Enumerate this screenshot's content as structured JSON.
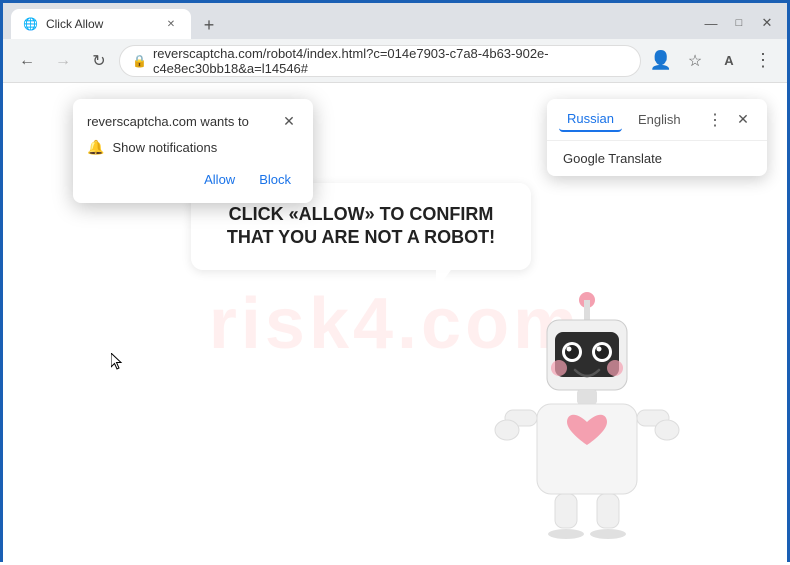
{
  "browser": {
    "tab": {
      "title": "Click Allow",
      "favicon": "🌐"
    },
    "new_tab_icon": "+",
    "nav": {
      "back_label": "←",
      "forward_label": "→",
      "reload_label": "↻"
    },
    "address": "reverscaptcha.com/robot4/index.html?c=014e7903-c7a8-4b63-902e-c4e8ec30bb18&a=l14546#",
    "window_controls": {
      "minimize": "—",
      "maximize": "□",
      "close": "✕"
    }
  },
  "notification_popup": {
    "title": "reverscaptcha.com wants to",
    "close_icon": "✕",
    "notification_label": "Show notifications",
    "allow_label": "Allow",
    "block_label": "Block"
  },
  "translation_popup": {
    "lang_russian": "Russian",
    "lang_english": "English",
    "option": "Google Translate",
    "menu_dots": "⋮",
    "close_icon": "✕"
  },
  "page": {
    "speech_bubble_text": "CLICK «ALLOW» TO CONFIRM THAT YOU ARE NOT A ROBOT!",
    "watermark": "risk4.com"
  }
}
